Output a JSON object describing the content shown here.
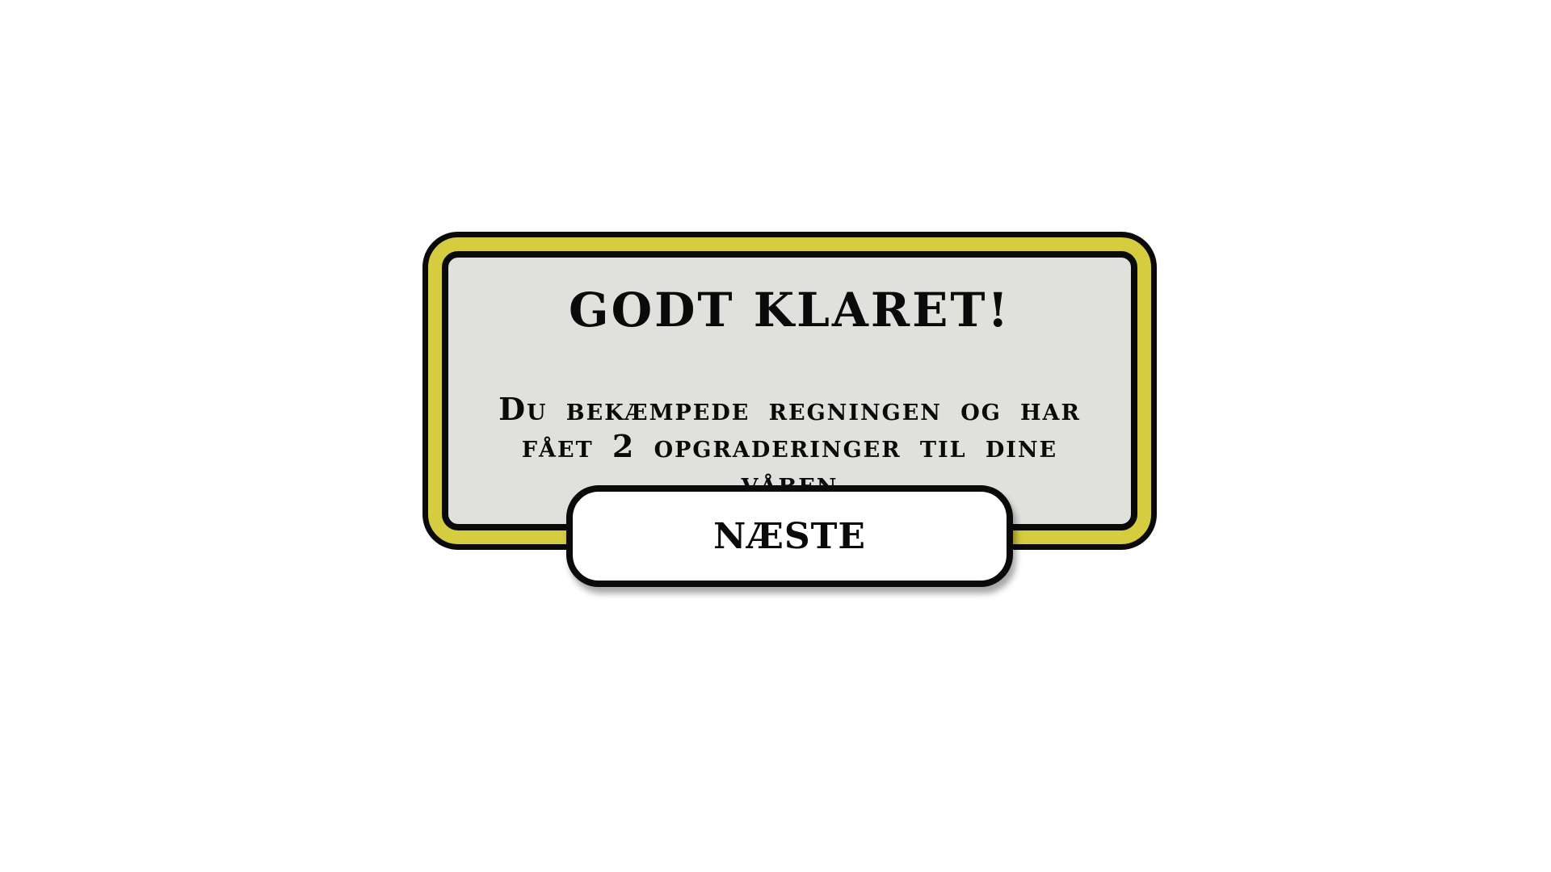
{
  "dialog": {
    "title": "GODT KLARET!",
    "message_lines": [
      "Du bekæmpede regningen og har",
      "fået 2 opgraderinger til dine våben"
    ],
    "next_label": "NÆSTE"
  },
  "colors": {
    "frame_yellow": "#d6cc3f",
    "panel_gray": "#e0e1dd",
    "outline_black": "#0a0a0a",
    "button_white": "#ffffff"
  }
}
